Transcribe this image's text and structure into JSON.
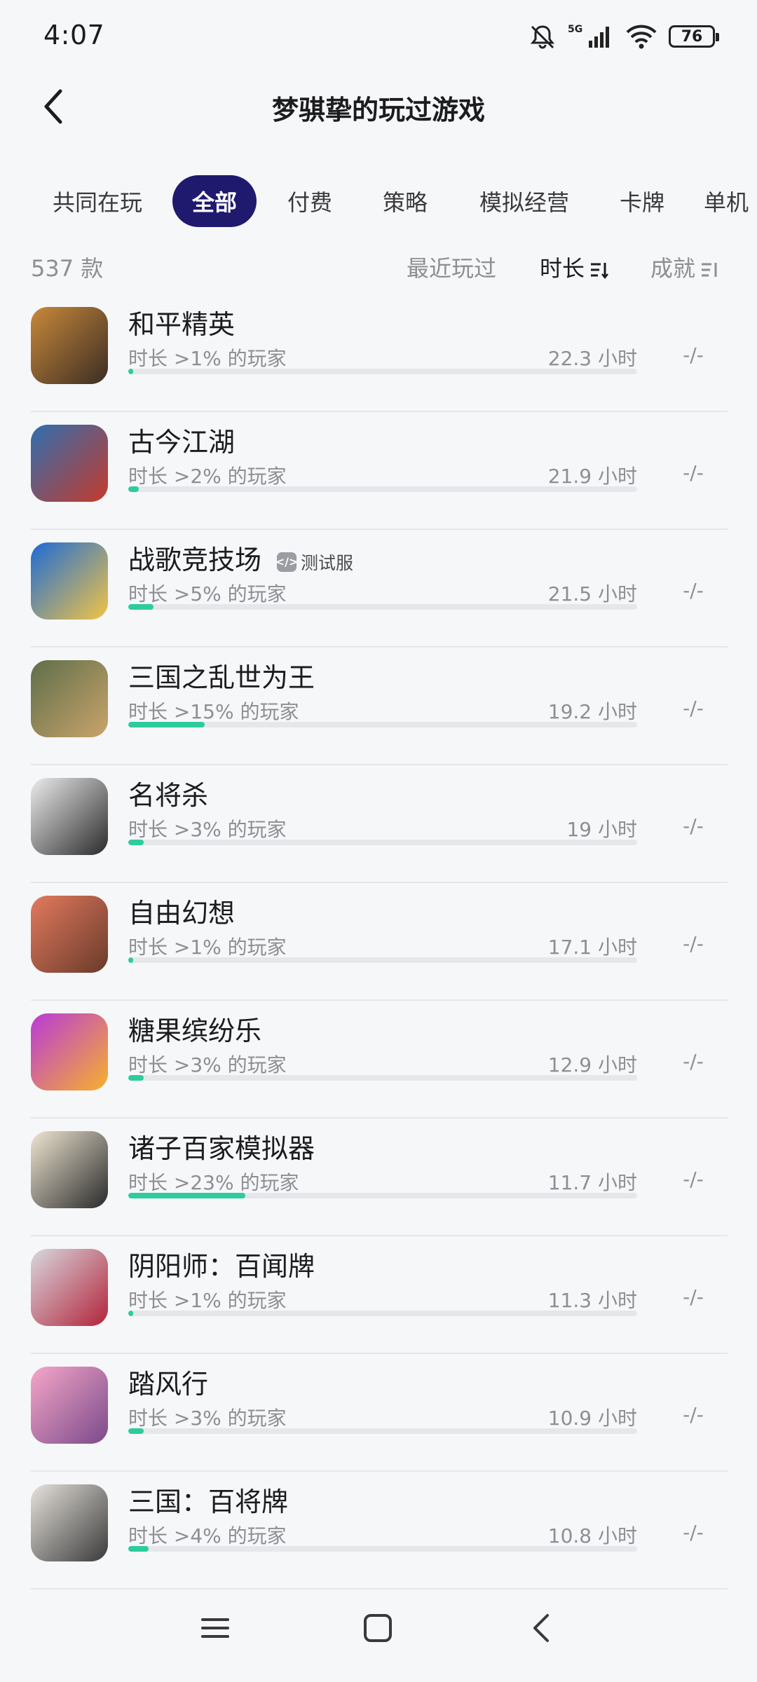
{
  "status": {
    "time": "4:07",
    "signal_label": "5G",
    "battery": "76"
  },
  "header": {
    "title": "梦骐挚的玩过游戏"
  },
  "tabs": [
    {
      "label": "共同在玩",
      "active": false
    },
    {
      "label": "全部",
      "active": true
    },
    {
      "label": "付费",
      "active": false
    },
    {
      "label": "策略",
      "active": false
    },
    {
      "label": "模拟经营",
      "active": false
    },
    {
      "label": "卡牌",
      "active": false
    },
    {
      "label": "单机",
      "active": false
    }
  ],
  "sort": {
    "count": "537 款",
    "recent": "最近玩过",
    "duration": "时长",
    "achievement": "成就"
  },
  "games": [
    {
      "name": "和平精英",
      "tag": "",
      "desc": "时长 >1% 的玩家",
      "hours": "22.3 小时",
      "achievement": "-/-",
      "progress": 0.01,
      "icon_color": "#c8893a",
      "icon_color2": "#3b2d24"
    },
    {
      "name": "古今江湖",
      "tag": "",
      "desc": "时长 >2% 的玩家",
      "hours": "21.9 小时",
      "achievement": "-/-",
      "progress": 0.02,
      "icon_color": "#2f6fb0",
      "icon_color2": "#c53a2c"
    },
    {
      "name": "战歌竞技场",
      "tag": "测试服",
      "desc": "时长 >5% 的玩家",
      "hours": "21.5 小时",
      "achievement": "-/-",
      "progress": 0.05,
      "icon_color": "#1d6bd6",
      "icon_color2": "#f2c445"
    },
    {
      "name": "三国之乱世为王",
      "tag": "",
      "desc": "时长 >15% 的玩家",
      "hours": "19.2 小时",
      "achievement": "-/-",
      "progress": 0.15,
      "icon_color": "#5e6e4a",
      "icon_color2": "#c9a46a"
    },
    {
      "name": "名将杀",
      "tag": "",
      "desc": "时长 >3% 的玩家",
      "hours": "19 小时",
      "achievement": "-/-",
      "progress": 0.03,
      "icon_color": "#ececec",
      "icon_color2": "#2b2b2b"
    },
    {
      "name": "自由幻想",
      "tag": "",
      "desc": "时长 >1% 的玩家",
      "hours": "17.1 小时",
      "achievement": "-/-",
      "progress": 0.01,
      "icon_color": "#e27a5e",
      "icon_color2": "#6a3a2a"
    },
    {
      "name": "糖果缤纷乐",
      "tag": "",
      "desc": "时长 >3% 的玩家",
      "hours": "12.9 小时",
      "achievement": "-/-",
      "progress": 0.03,
      "icon_color": "#b93ad8",
      "icon_color2": "#f7b12c"
    },
    {
      "name": "诸子百家模拟器",
      "tag": "",
      "desc": "时长 >23% 的玩家",
      "hours": "11.7 小时",
      "achievement": "-/-",
      "progress": 0.23,
      "icon_color": "#efe6d2",
      "icon_color2": "#2a2a2a"
    },
    {
      "name": "阴阳师：百闻牌",
      "tag": "",
      "desc": "时长 >1% 的玩家",
      "hours": "11.3 小时",
      "achievement": "-/-",
      "progress": 0.01,
      "icon_color": "#d8d8df",
      "icon_color2": "#b2243a"
    },
    {
      "name": "踏风行",
      "tag": "",
      "desc": "时长 >3% 的玩家",
      "hours": "10.9 小时",
      "achievement": "-/-",
      "progress": 0.03,
      "icon_color": "#f5a6c8",
      "icon_color2": "#7a4a8a"
    },
    {
      "name": "三国：百将牌",
      "tag": "",
      "desc": "时长 >4% 的玩家",
      "hours": "10.8 小时",
      "achievement": "-/-",
      "progress": 0.04,
      "icon_color": "#e6e2dc",
      "icon_color2": "#3a3a3a"
    }
  ],
  "colors": {
    "accent": "#1f1a6e",
    "progress": "#2ccc9c",
    "track": "#e6e7ea"
  }
}
